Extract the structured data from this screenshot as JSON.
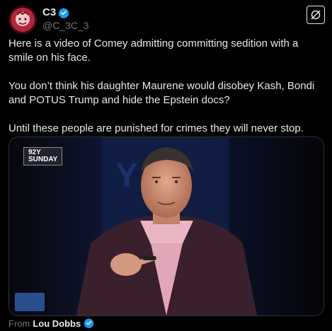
{
  "author": {
    "display_name": "C3",
    "handle": "@C_3C_3",
    "verified_color": "#1d9bf0"
  },
  "post": {
    "paragraphs": [
      "Here is a video of Comey admitting committing sedition with a smile on his face.",
      "You don’t think his daughter Maurene would disobey Kash, Bondi and POTUS Trump and hide the Epstein docs?",
      "Until these people are punished for crimes they will never stop."
    ]
  },
  "media": {
    "overlay_line1": "92Y",
    "overlay_line2": "SUNDAY"
  },
  "attribution": {
    "prefix": "From",
    "source": "Lou Dobbs"
  },
  "icons": {
    "grok": "grok-icon",
    "verified": "verified-badge-icon"
  }
}
